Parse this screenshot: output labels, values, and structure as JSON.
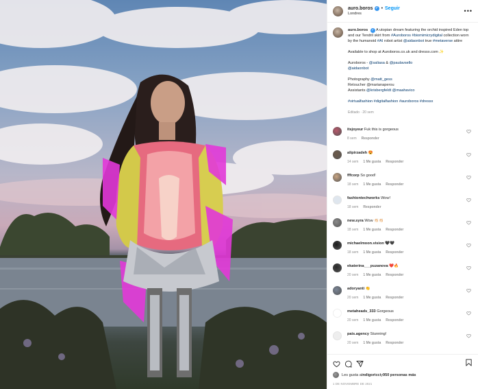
{
  "post": {
    "username": "auro.boros",
    "verified_glyph": "✓",
    "separator": "•",
    "follow_label": "Seguir",
    "location": "Londres",
    "more_label": "•••"
  },
  "caption": {
    "username": "auro.boros",
    "text1": " A utopian dream featuring the orchid inspired Eden top and our Tendril skirt from ",
    "tag1": "#Auroboros",
    "text1b": " ",
    "tag2": "#biomimicrydigital",
    "text1c": " collection worn by the humanoid ",
    "tag3": "#AI",
    "text1d": " robot artist ",
    "mention1": "@aidaonbot",
    "text1e": " true ",
    "tag4": "#metaverse",
    "text1f": " attire",
    "para2": "Available to shop at Auroboros.co.uk and dressx.com ✨",
    "para3_prefix": "Auroboros - ",
    "mention2": "@saliasa",
    "para3_mid": " & ",
    "mention3": "@paulavsello",
    "mention4": "@aidaonbot",
    "credit1_label": "Photography ",
    "credit1_mention": "@matt_gess",
    "credit2": "Retoucher @marianaperou",
    "credit3_label": "Assistants ",
    "credit3_m1": "@krisbergfeldt",
    "credit3_mid": " ",
    "credit3_m2": "@maahavico",
    "hashtags": "#virtualfashion #digitalfashion #auroboros #dressx",
    "edited": "Editado · 20 sem"
  },
  "comments": [
    {
      "user": "itsjoyeur",
      "text": "Fuk this is gorgeous",
      "time": "8 sem",
      "likes": "",
      "reply": "Responder",
      "avatar": "#b8586a"
    },
    {
      "user": "alipirzadeh",
      "text": "😍",
      "time": "14 sem",
      "likes": "1 Me gusta",
      "reply": "Responder",
      "avatar": "#6d5a4a"
    },
    {
      "user": "fffcorp",
      "text": "So good!",
      "time": "18 sem",
      "likes": "1 Me gusta",
      "reply": "Responder",
      "avatar": "#c9a583"
    },
    {
      "user": "fashiontechworks",
      "text": "Wow!",
      "time": "18 sem",
      "likes": "",
      "reply": "Responder",
      "avatar": "#dfe6ee"
    },
    {
      "user": "new.syra",
      "text": "Wow 👏🏻👏🏻",
      "time": "18 sem",
      "likes": "1 Me gusta",
      "reply": "Responder",
      "avatar": "#8a8a8a"
    },
    {
      "user": "michaelmoon.vision",
      "text": "🖤🖤",
      "time": "18 sem",
      "likes": "1 Me gusta",
      "reply": "Responder",
      "avatar": "#1c1c1c"
    },
    {
      "user": "ekaterina___puzanova",
      "text": "❤️🔥",
      "time": "20 sem",
      "likes": "1 Me gusta",
      "reply": "Responder",
      "avatar": "#2a2a2a"
    },
    {
      "user": "adoryanti",
      "text": "👏",
      "time": "20 sem",
      "likes": "1 Me gusta",
      "reply": "Responder",
      "avatar": "#7a8596"
    },
    {
      "user": "metaheads_333",
      "text": "Gorgeous",
      "time": "20 sem",
      "likes": "1 Me gusta",
      "reply": "Responder",
      "avatar": "#ffffff"
    },
    {
      "user": "pais.agency",
      "text": "Stunning!",
      "time": "20 sem",
      "likes": "1 Me gusta",
      "reply": "Responder",
      "avatar": "#eeeeee"
    }
  ],
  "actions": {
    "likes_prefix": "Les gusta a ",
    "likes_user": "indigoricci",
    "likes_mid": " y ",
    "likes_count": "950 personas más",
    "date": "1 DE NOVIEMBRE DE 2021"
  },
  "icons": {
    "like": "heart-icon",
    "comment": "comment-icon",
    "share": "share-icon",
    "save": "bookmark-icon",
    "comment_like": "heart-icon"
  },
  "colors": {
    "link": "#00376b",
    "accent": "#0095f6",
    "verified": "#3897f0",
    "muted": "#8e8e8e"
  }
}
